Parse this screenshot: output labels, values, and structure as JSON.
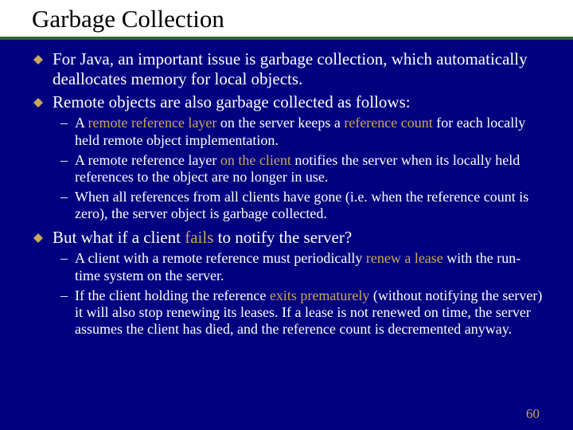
{
  "title": "Garbage Collection",
  "slide_number": "60",
  "bullets": {
    "b1": "For Java, an important issue is garbage collection, which automatically deallocates memory for local objects.",
    "b2": "Remote objects are also garbage collected as follows:",
    "b2a_pre": "A ",
    "b2a_em": "remote reference layer",
    "b2a_mid": " on the server keeps a ",
    "b2a_em2": "reference count",
    "b2a_post": " for each locally held remote object implementation.",
    "b2b_pre": "A remote reference layer ",
    "b2b_em": "on the client",
    "b2b_post": " notifies the server when its locally held references to the object are no longer in use.",
    "b2c": "When all references from all clients have gone (i.e. when the reference count is zero), the server object is garbage collected.",
    "b3_pre": "But what if a client ",
    "b3_em": "fails",
    "b3_post": " to notify the server?",
    "b3a_pre": "A client with a remote reference must periodically ",
    "b3a_em": "renew a lease",
    "b3a_post": " with the run-time system on the server.",
    "b3b_pre": "If the client holding the reference ",
    "b3b_em": "exits prematurely",
    "b3b_post": " (without notifying the server) it will also stop renewing its leases.  If a lease is not renewed on time, the server assumes the client has died, and the reference count is decremented anyway."
  }
}
